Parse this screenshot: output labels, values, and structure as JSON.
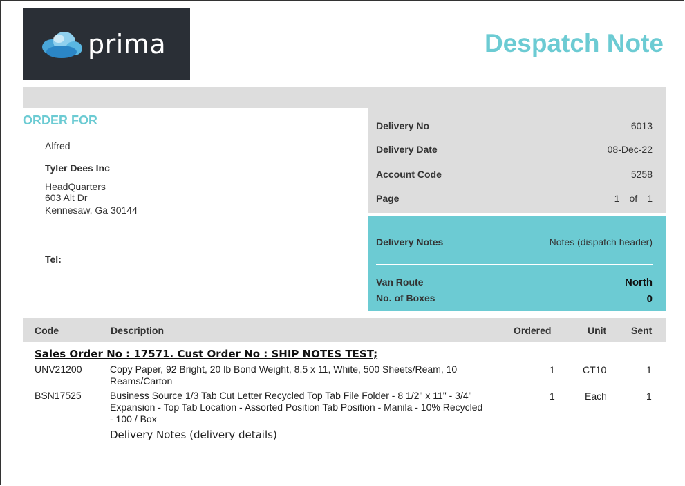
{
  "logo": {
    "text": "prima",
    "icon": "cloud-logo-icon"
  },
  "title": "Despatch Note",
  "order_for": {
    "heading": "ORDER FOR",
    "contact": "Alfred",
    "company": "Tyler Dees Inc",
    "address_lines": [
      "HeadQuarters",
      "603 Alt Dr",
      "Kennesaw, Ga 30144"
    ],
    "tel_label": "Tel:"
  },
  "info": {
    "delivery_no_label": "Delivery No",
    "delivery_no": "6013",
    "delivery_date_label": "Delivery Date",
    "delivery_date": "08-Dec-22",
    "account_code_label": "Account Code",
    "account_code": "5258",
    "page_label": "Page",
    "page_current": "1",
    "page_of": "of",
    "page_total": "1"
  },
  "notes": {
    "delivery_notes_label": "Delivery Notes",
    "delivery_notes_value": "Notes (dispatch header)",
    "van_route_label": "Van Route",
    "van_route": "North",
    "boxes_label": "No. of Boxes",
    "boxes": "0"
  },
  "table": {
    "headers": {
      "code": "Code",
      "description": "Description",
      "ordered": "Ordered",
      "unit": "Unit",
      "sent": "Sent"
    },
    "sales_order_line": "Sales Order No : 17571. Cust Order No : SHIP NOTES TEST;",
    "rows": [
      {
        "code": "UNV21200",
        "description": "Copy Paper, 92 Bright, 20 lb Bond Weight, 8.5 x 11, White, 500 Sheets/Ream, 10 Reams/Carton",
        "ordered": "1",
        "unit": "CT10",
        "sent": "1"
      },
      {
        "code": "BSN17525",
        "description": "Business Source 1/3 Tab Cut Letter Recycled Top Tab File Folder - 8 1/2\" x 11\" - 3/4\" Expansion - Top Tab Location - Assorted Position Tab Position - Manila - 10% Recycled - 100 / Box",
        "ordered": "1",
        "unit": "Each",
        "sent": "1"
      }
    ],
    "footnote": "Delivery Notes (delivery details)"
  },
  "colors": {
    "accent": "#6ccbd3",
    "panel": "#dddddd",
    "logo_bg": "#2a2f36"
  }
}
